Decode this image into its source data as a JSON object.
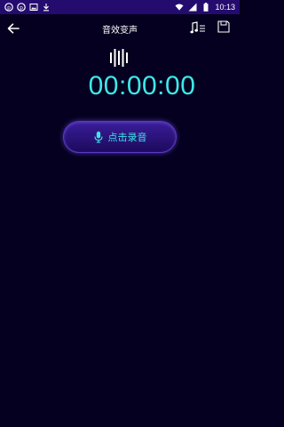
{
  "status_bar": {
    "time": "10:13",
    "icons": [
      "notification-p-icon",
      "notification-p-icon",
      "image-icon",
      "download-icon",
      "wifi-icon",
      "signal-icon",
      "battery-icon"
    ]
  },
  "header": {
    "title": "音效变声",
    "back_icon": "back-arrow-icon",
    "music_list_icon": "music-list-icon",
    "save_icon": "save-icon"
  },
  "recorder": {
    "wave_icon": "sound-wave-icon",
    "elapsed": "00:00:00",
    "record_label": "点击录音",
    "mic_icon": "microphone-icon"
  },
  "colors": {
    "background": "#05001f",
    "status_bar": "#240b6e",
    "accent_cyan": "#3ee8e8",
    "button_purple": "#3a1d9a"
  }
}
